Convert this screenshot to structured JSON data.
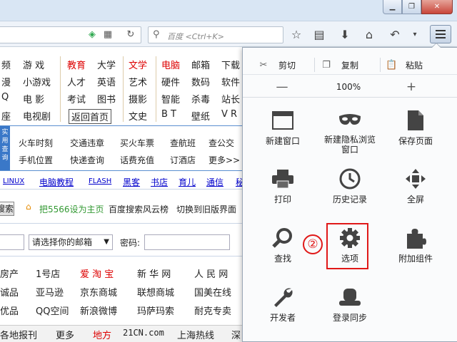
{
  "search": {
    "placeholder": "百度 <Ctrl+K>"
  },
  "page": {
    "nav_rows": [
      [
        "频",
        "游 戏",
        "教育",
        "大学",
        "文学",
        "电脑",
        "邮箱",
        "下载"
      ],
      [
        "漫",
        "小游戏",
        "人才",
        "英语",
        "艺术",
        "硬件",
        "数码",
        "软件"
      ],
      [
        "Q",
        "电 影",
        "考试",
        "图书",
        "摄影",
        "智能",
        "杀毒",
        "站长"
      ],
      [
        "座",
        "电视剧",
        "返回首页",
        "文史",
        "B T",
        "壁纸",
        "V R"
      ]
    ],
    "query_tab": "实用查询",
    "query_row1": [
      "火车时刻",
      "交通违章",
      "买火车票",
      "查航班",
      "查公交"
    ],
    "query_row2": [
      "手机位置",
      "快递查询",
      "话费充值",
      "订酒店",
      "更多>>"
    ],
    "link_row": [
      "LINUX",
      "电脑教程",
      "FLASH",
      "黑客",
      "书店",
      "育儿",
      "通信",
      "秘"
    ],
    "search_btn": "搜索",
    "homepage_links": [
      "把5566设为主页",
      "百度搜索风云榜",
      "切换到旧版界面"
    ],
    "mail_select": "请选择你的邮箱",
    "password_label": "密码:",
    "shop_rows": [
      [
        "房产",
        "1号店",
        "爱 淘 宝",
        "新 华 网",
        "人 民 网"
      ],
      [
        "诚品",
        "亚马逊",
        "京东商城",
        "联想商城",
        "国美在线"
      ],
      [
        "优品",
        "QQ空间",
        "新浪微博",
        "玛萨玛索",
        "耐克专卖"
      ]
    ],
    "bottom_row": [
      "各地报刊",
      "更多",
      "地方",
      "21CN.com",
      "上海热线",
      "深"
    ]
  },
  "menu": {
    "edit": {
      "cut": "剪切",
      "copy": "复制",
      "paste": "粘贴"
    },
    "zoom": {
      "minus": "—",
      "level": "100%",
      "plus": "+"
    },
    "items": [
      {
        "label": "新建窗口",
        "icon": "new-window-icon"
      },
      {
        "label": "新建隐私浏览窗口",
        "icon": "private-mask-icon"
      },
      {
        "label": "保存页面",
        "icon": "save-page-icon"
      },
      {
        "label": "打印",
        "icon": "print-icon"
      },
      {
        "label": "历史记录",
        "icon": "history-clock-icon"
      },
      {
        "label": "全屏",
        "icon": "fullscreen-icon"
      },
      {
        "label": "查找",
        "icon": "find-icon"
      },
      {
        "label": "选项",
        "icon": "options-gear-icon"
      },
      {
        "label": "附加组件",
        "icon": "addons-puzzle-icon"
      },
      {
        "label": "开发者",
        "icon": "developer-wrench-icon"
      },
      {
        "label": "登录同步",
        "icon": "sync-hat-icon"
      }
    ],
    "annotation": "②"
  },
  "colors": {
    "highlight": "#e01818",
    "link": "#0033cc",
    "accent_red": "#dd0000"
  }
}
